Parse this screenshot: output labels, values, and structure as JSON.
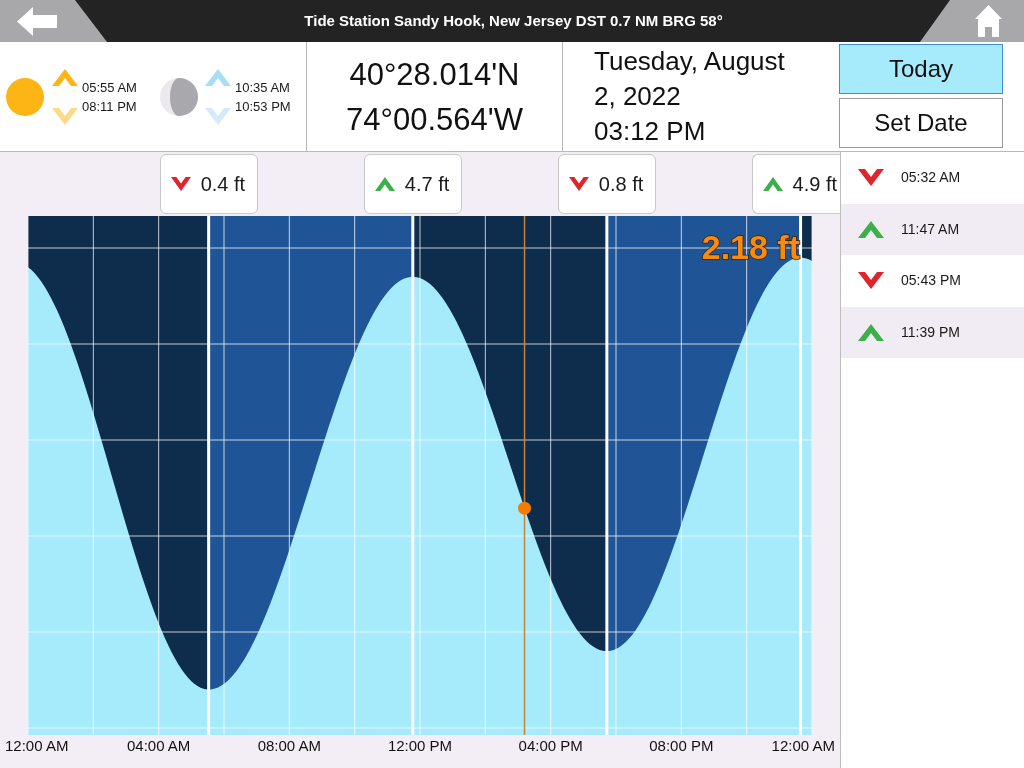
{
  "header": {
    "title": "Tide Station Sandy Hook, New Jersey DST 0.7 NM BRG 58°"
  },
  "sun": {
    "rise": "05:55 AM",
    "set": "08:11 PM"
  },
  "moon": {
    "rise": "10:35 AM",
    "set": "10:53 PM"
  },
  "position": {
    "latitude": "40°28.014'N",
    "longitude": "74°00.564'W"
  },
  "date": {
    "day": "Tuesday, August 2, 2022",
    "time": "03:12 PM"
  },
  "date_buttons": [
    {
      "label": "Today",
      "selected": true
    },
    {
      "label": "Set Date",
      "selected": false
    }
  ],
  "tide_graph": {
    "tags": [
      {
        "kind": "low",
        "text": "0.4 ft"
      },
      {
        "kind": "high",
        "text": "4.7 ft"
      },
      {
        "kind": "low",
        "text": "0.8 ft"
      },
      {
        "kind": "high",
        "text": "4.9 ft"
      }
    ],
    "current_reading": "2.18 ft",
    "time_labels": [
      "12:00 AM",
      "04:00 AM",
      "08:00 AM",
      "12:00 PM",
      "04:00 PM",
      "08:00 PM",
      "12:00 AM"
    ]
  },
  "tide_times": [
    {
      "kind": "low",
      "time": "05:32 AM"
    },
    {
      "kind": "high",
      "time": "11:47 AM"
    },
    {
      "kind": "low",
      "time": "05:43 PM"
    },
    {
      "kind": "high",
      "time": "11:39 PM"
    }
  ]
}
